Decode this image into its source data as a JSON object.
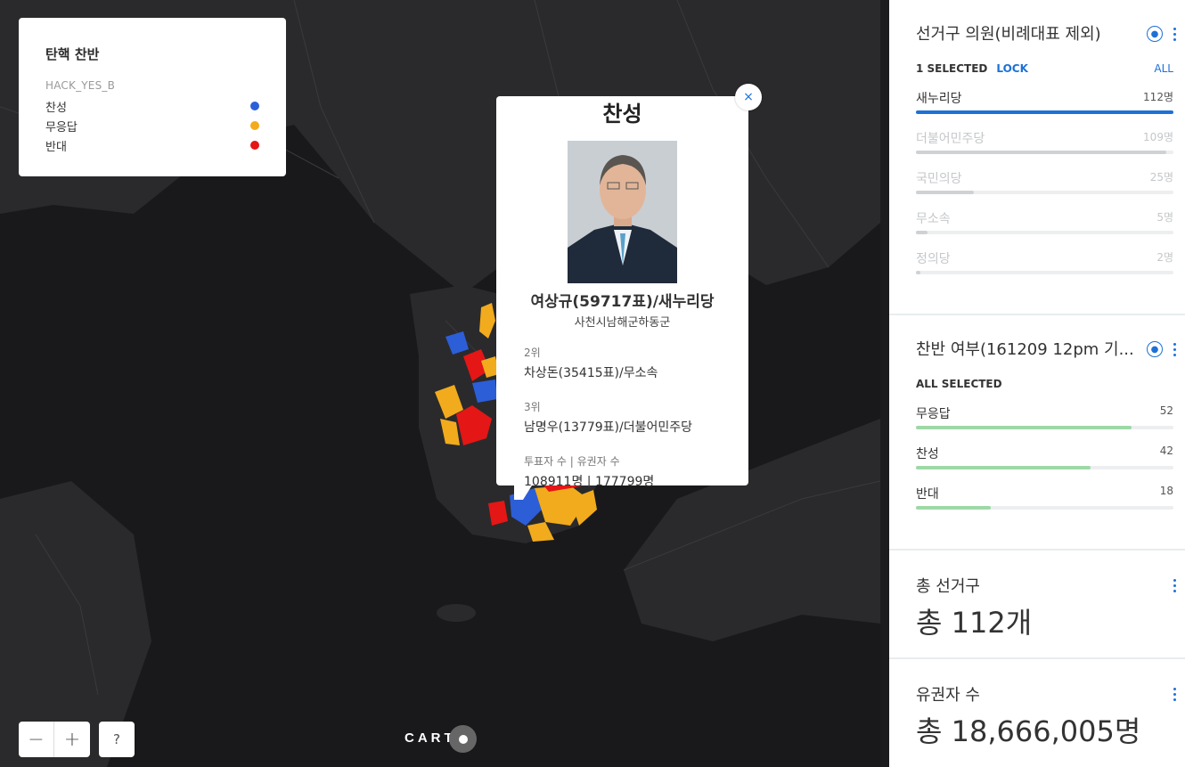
{
  "legend": {
    "title": "탄핵 찬반",
    "field": "HACK_YES_B",
    "items": [
      {
        "label": "찬성",
        "color": "#2c5ed8"
      },
      {
        "label": "무응답",
        "color": "#f2ab1c"
      },
      {
        "label": "반대",
        "color": "#e41616"
      }
    ]
  },
  "controls": {
    "zoom_out": "−",
    "zoom_in": "+",
    "help": "?"
  },
  "attribution": "CART",
  "popup": {
    "title": "찬성",
    "close": "×",
    "winner": "여상규(59717표)/새누리당",
    "district": "사천시남해군하동군",
    "second_label": "2위",
    "second_value": "차상돈(35415표)/무소속",
    "third_label": "3위",
    "third_value": "남명우(13779표)/더불어민주당",
    "votes_label": "투표자 수 | 유권자 수",
    "votes_value": "108911명 | 177799명"
  },
  "widgets": {
    "party": {
      "title": "선거구 의원(비례대표 제외)",
      "selected": "1 SELECTED",
      "lock": "LOCK",
      "all": "ALL",
      "items": [
        {
          "name": "새누리당",
          "count": "112명",
          "value": 112,
          "active": true
        },
        {
          "name": "더불어민주당",
          "count": "109명",
          "value": 109,
          "active": false
        },
        {
          "name": "국민의당",
          "count": "25명",
          "value": 25,
          "active": false
        },
        {
          "name": "무소속",
          "count": "5명",
          "value": 5,
          "active": false
        },
        {
          "name": "정의당",
          "count": "2명",
          "value": 2,
          "active": false
        }
      ]
    },
    "vote": {
      "title": "찬반 여부(161209 12pm 기...",
      "selected": "ALL SELECTED",
      "items": [
        {
          "name": "무응답",
          "count": "52",
          "value": 52
        },
        {
          "name": "찬성",
          "count": "42",
          "value": 42
        },
        {
          "name": "반대",
          "count": "18",
          "value": 18
        }
      ]
    },
    "districts": {
      "title": "총 선거구",
      "value": "총 112개"
    },
    "voters": {
      "title": "유권자 수",
      "value": "총 18,666,005명"
    }
  },
  "colors": {
    "accent": "#1d71d6",
    "bar_green": "#9ed8a7"
  }
}
